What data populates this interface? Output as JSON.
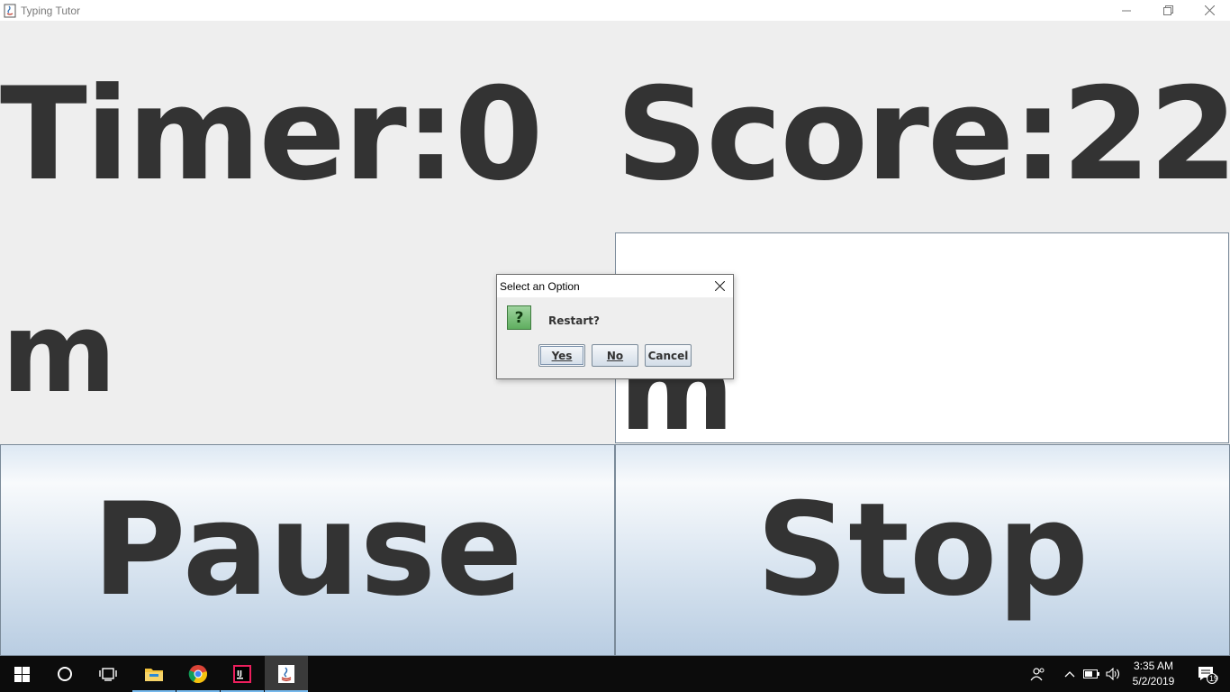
{
  "window": {
    "title": "Typing Tutor"
  },
  "game": {
    "timer_text": "Timer:0",
    "score_text": "Score:22",
    "current_word": "m",
    "typed_text": "m",
    "pause_label": "Pause",
    "stop_label": "Stop"
  },
  "dialog": {
    "title": "Select an Option",
    "message": "Restart?",
    "icon": "question-icon",
    "buttons": {
      "yes": "Yes",
      "no": "No",
      "cancel": "Cancel"
    }
  },
  "taskbar": {
    "pinned": [
      "start",
      "cortana-search",
      "task-view",
      "file-explorer",
      "chrome",
      "intellij",
      "java"
    ],
    "clock_time": "3:35 AM",
    "clock_date": "5/2/2019",
    "notification_count": "19"
  },
  "colors": {
    "text_dark": "#333333",
    "panel_bg": "#eeeeee",
    "taskbar_bg": "#0c0c0c",
    "accent": "#76b9ed"
  }
}
